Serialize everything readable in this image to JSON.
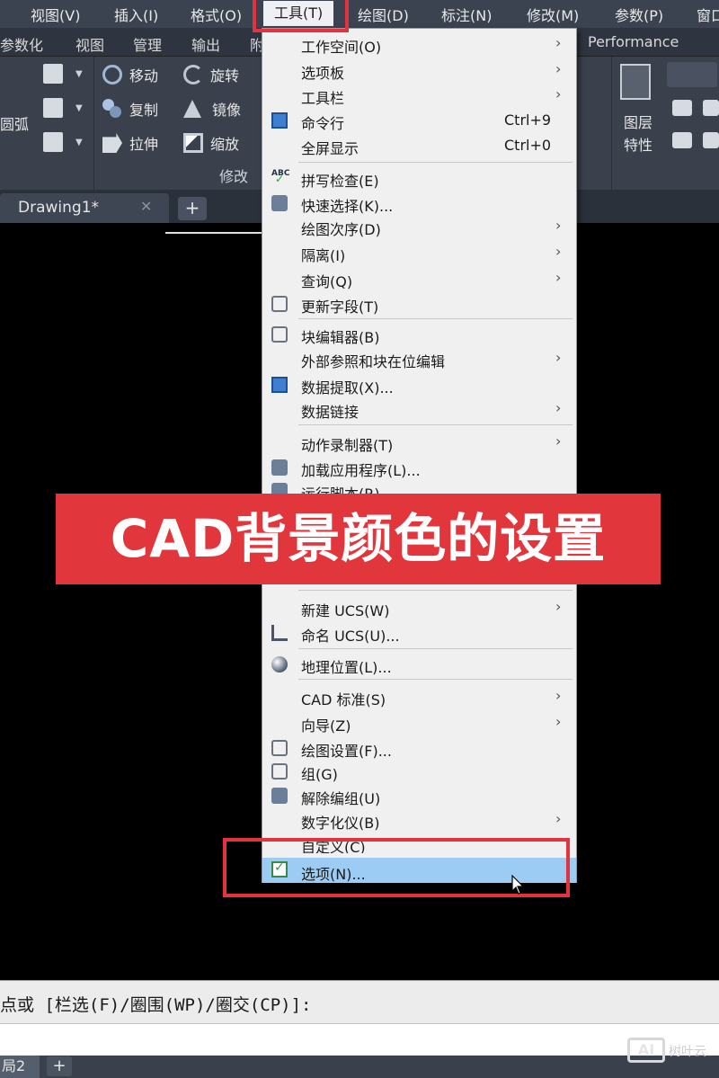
{
  "menubar": {
    "items": [
      "视图(V)",
      "插入(I)",
      "格式(O)",
      "工具(T)",
      "绘图(D)",
      "标注(N)",
      "修改(M)",
      "参数(P)",
      "窗口"
    ]
  },
  "ribbon_tabs": [
    "参数化",
    "视图",
    "管理",
    "输出",
    "附",
    "Performance"
  ],
  "ribbon": {
    "left_label": "圆弧",
    "move": "移动",
    "rotate": "旋转",
    "copy": "复制",
    "mirror": "镜像",
    "stretch": "拉伸",
    "scale": "缩放",
    "panel_title": "修改",
    "layer_line1": "图层",
    "layer_line2": "特性"
  },
  "doc_tabs": {
    "active": "Drawing1*",
    "close": "✕",
    "add": "+"
  },
  "menu": {
    "items": [
      {
        "label": "工作空间(O)",
        "submenu": true
      },
      {
        "label": "选项板",
        "submenu": true
      },
      {
        "label": "工具栏",
        "submenu": true
      },
      {
        "label": "命令行",
        "shortcut": "Ctrl+9",
        "icon": "command-line-icon"
      },
      {
        "label": "全屏显示",
        "shortcut": "Ctrl+0"
      },
      {
        "label": "拼写检查(E)",
        "icon": "spell-check-icon"
      },
      {
        "label": "快速选择(K)...",
        "icon": "quick-select-icon"
      },
      {
        "label": "绘图次序(D)",
        "submenu": true
      },
      {
        "label": "隔离(I)",
        "submenu": true
      },
      {
        "label": "查询(Q)",
        "submenu": true
      },
      {
        "label": "更新字段(T)",
        "icon": "update-field-icon"
      },
      {
        "label": "块编辑器(B)",
        "icon": "block-editor-icon"
      },
      {
        "label": "外部参照和块在位编辑",
        "submenu": true
      },
      {
        "label": "数据提取(X)...",
        "icon": "data-extraction-icon"
      },
      {
        "label": "数据链接",
        "submenu": true
      },
      {
        "label": "动作录制器(T)",
        "submenu": true
      },
      {
        "label": "加载应用程序(L)...",
        "icon": "load-application-icon"
      },
      {
        "label": "运行脚本(R)...",
        "icon": "run-script-icon"
      },
      {
        "label": "新建 UCS(W)",
        "submenu": true
      },
      {
        "label": "命名 UCS(U)...",
        "icon": "named-ucs-icon"
      },
      {
        "label": "地理位置(L)...",
        "icon": "geolocation-icon"
      },
      {
        "label": "CAD 标准(S)",
        "submenu": true
      },
      {
        "label": "向导(Z)",
        "submenu": true
      },
      {
        "label": "绘图设置(F)...",
        "icon": "drafting-settings-icon"
      },
      {
        "label": "组(G)",
        "icon": "group-icon"
      },
      {
        "label": "解除编组(U)",
        "icon": "ungroup-icon"
      },
      {
        "label": "数字化仪(B)",
        "submenu": true
      },
      {
        "label": "自定义(C)"
      },
      {
        "label": "选项(N)...",
        "icon": "options-icon",
        "selected": true
      }
    ]
  },
  "overlay_title": "CAD背景颜色的设置",
  "command_line": {
    "prompt": "点或 [栏选(F)/圈围(WP)/圈交(CP)]:"
  },
  "layout_tabs": {
    "tab": "局2",
    "add": "+"
  },
  "watermark": {
    "logo": "AI",
    "text": "树叶云"
  },
  "colors": {
    "highlight_red": "#e2333e",
    "menu_selected": "#9cccf4",
    "menubar_bg": "#3b4351",
    "canvas_bg": "#000000"
  }
}
